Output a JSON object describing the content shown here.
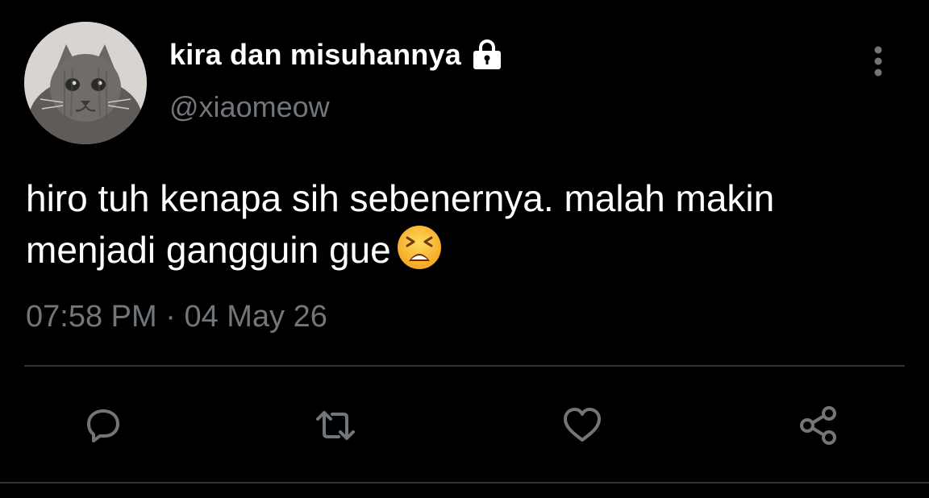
{
  "tweet": {
    "display_name": "kira dan misuhannya",
    "handle": "@xiaomeow",
    "text_line1": "hiro tuh kenapa sih sebenernya. malah makin",
    "text_line2": "menjadi gangguin gue",
    "emoji": "tired-face-emoji",
    "time": "07:58 PM",
    "separator": "·",
    "date": "04 May 26",
    "protected_icon": "lock-icon"
  },
  "actions": {
    "reply_icon": "reply-icon",
    "retweet_icon": "retweet-icon",
    "like_icon": "like-icon",
    "share_icon": "share-icon",
    "more_icon": "more-vertical-icon"
  },
  "colors": {
    "background": "#000000",
    "primary_text": "#ffffff",
    "secondary_text": "#71767b",
    "icon": "#71767b",
    "divider": "#2f3336"
  }
}
